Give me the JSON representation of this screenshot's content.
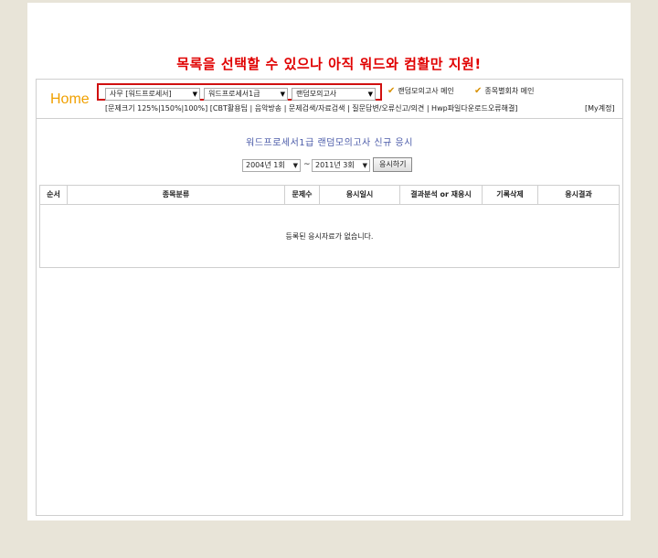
{
  "notice": "목록을 선택할 수 있으나 아직 워드와 컴활만 지원!",
  "header": {
    "home": "Home",
    "selects": [
      {
        "value": "사무 [워드프로세서]"
      },
      {
        "value": "워드프로세서1급"
      },
      {
        "value": "랜덤모의고사"
      }
    ],
    "links": [
      "랜덤모의고사 메인",
      "종목별회차 메인"
    ],
    "nav": "[문제크기 125%|150%|100%] [CBT활용팁 | 음악방송 | 문제검색/자료검색 | 질문답변/오류신고/의견 | Hwp파일다운로드오류해결]",
    "account": "[My계정]"
  },
  "exam": {
    "title": "워드프로세서1급 랜덤모의고사 신규 응시",
    "from": "2004년 1회",
    "tilde": "~",
    "to": "2011년 3회",
    "button": "응시하기"
  },
  "table": {
    "columns": [
      "순서",
      "종목분류",
      "문제수",
      "응시일시",
      "결과분석 or 재응시",
      "기록삭제",
      "응시결과"
    ],
    "empty_message": "등록된 응시자료가 없습니다."
  },
  "colors": {
    "notice": "#e00000",
    "home": "#f0a000",
    "highlight_box": "#d01010",
    "title": "#4a5aa8"
  }
}
